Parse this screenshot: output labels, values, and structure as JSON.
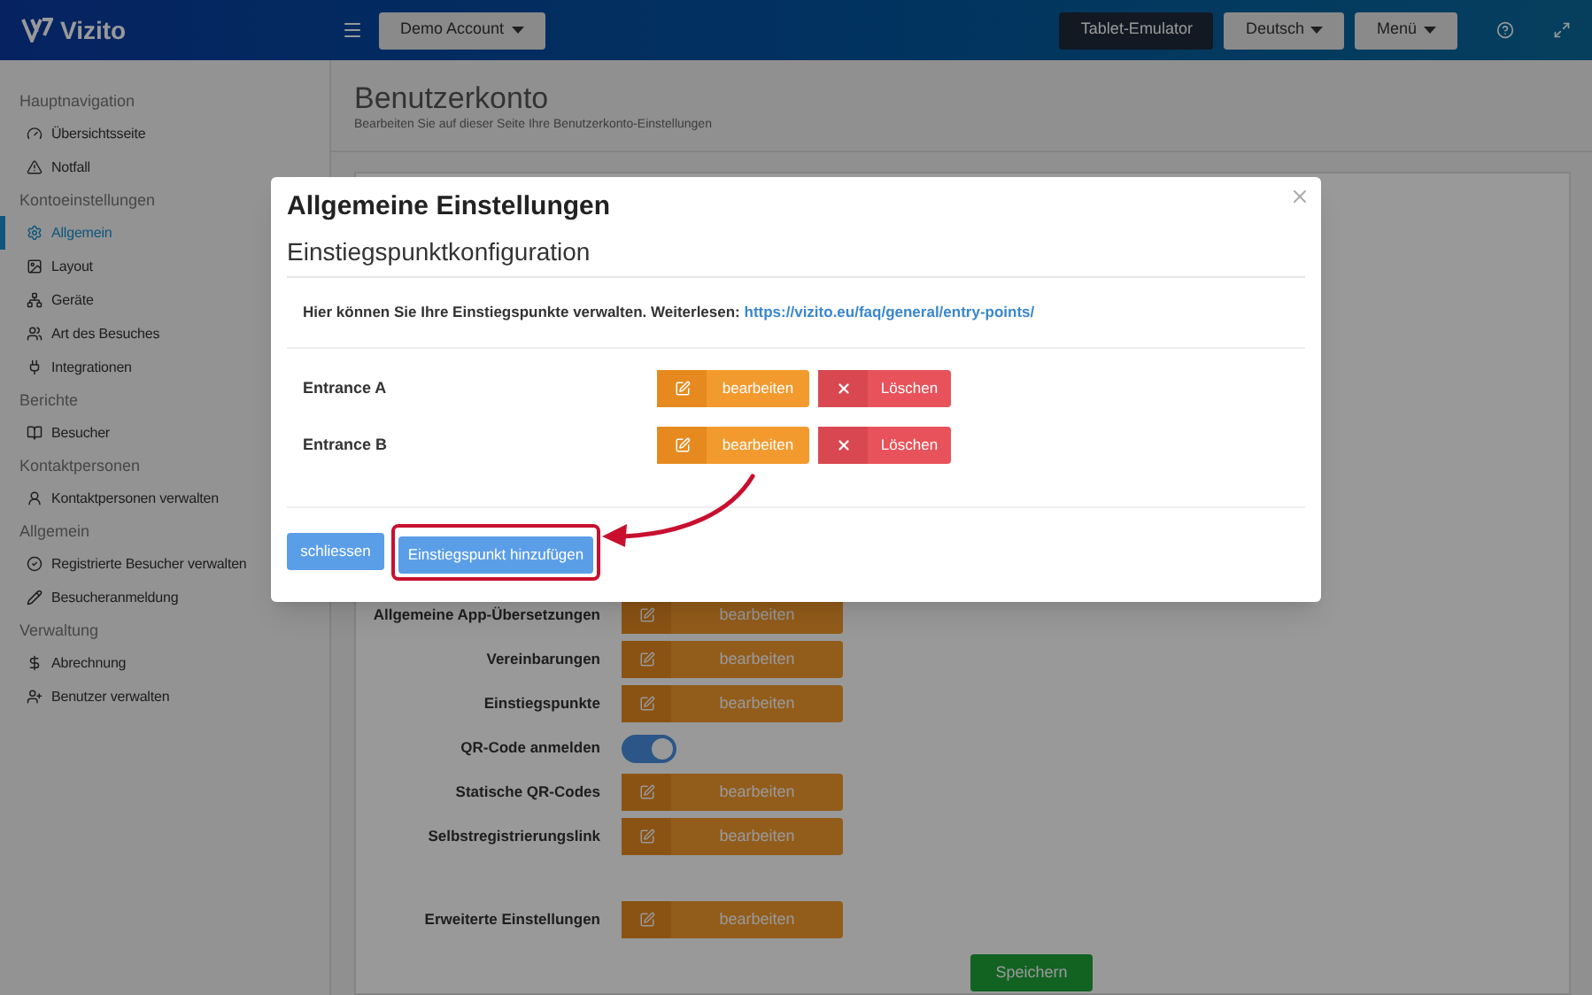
{
  "header": {
    "logo": "Vizito",
    "account": "Demo Account",
    "buttons": [
      {
        "label": "Tablet-Emulator",
        "kind": "dark"
      },
      {
        "label": "Deutsch",
        "kind": "dropdown"
      },
      {
        "label": "Menü",
        "kind": "dropdown"
      }
    ]
  },
  "sidebar": {
    "sections": [
      {
        "title": "Hauptnavigation",
        "items": [
          {
            "label": "Übersichtsseite",
            "selected": false
          },
          {
            "label": "Notfall",
            "selected": false
          }
        ]
      },
      {
        "title": "Kontoeinstellungen",
        "items": [
          {
            "label": "Allgemein",
            "selected": true
          },
          {
            "label": "Layout",
            "selected": false
          },
          {
            "label": "Geräte",
            "selected": false
          },
          {
            "label": "Art des Besuches",
            "selected": false
          },
          {
            "label": "Integrationen",
            "selected": false
          }
        ]
      },
      {
        "title": "Berichte",
        "items": [
          {
            "label": "Besucher",
            "selected": false
          }
        ]
      },
      {
        "title": "Kontaktpersonen",
        "items": [
          {
            "label": "Kontaktpersonen verwalten",
            "selected": false
          }
        ]
      },
      {
        "title": "Allgemein",
        "items": [
          {
            "label": "Registrierte Besucher verwalten",
            "selected": false
          },
          {
            "label": "Besucheranmeldung",
            "selected": false
          }
        ]
      },
      {
        "title": "Verwaltung",
        "items": [
          {
            "label": "Abrechnung",
            "selected": false
          },
          {
            "label": "Benutzer verwalten",
            "selected": false
          }
        ]
      }
    ]
  },
  "page": {
    "title": "Benutzerkonto",
    "subtitle": "Bearbeiten Sie auf dieser Seite Ihre Benutzerkonto-Einstellungen"
  },
  "settings": {
    "rows": [
      {
        "label": "Allgemeine App-Übersetzungen",
        "kind": "button",
        "button": "bearbeiten"
      },
      {
        "label": "Vereinbarungen",
        "kind": "button",
        "button": "bearbeiten"
      },
      {
        "label": "Einstiegspunkte",
        "kind": "button",
        "button": "bearbeiten"
      },
      {
        "label": "QR-Code anmelden",
        "kind": "toggle",
        "on": true
      },
      {
        "label": "Statische QR-Codes",
        "kind": "button",
        "button": "bearbeiten"
      },
      {
        "label": "Selbstregistrierungslink",
        "kind": "button",
        "button": "bearbeiten"
      }
    ],
    "advanced": {
      "label": "Erweiterte Einstellungen",
      "button": "bearbeiten"
    },
    "save": "Speichern"
  },
  "modal": {
    "title": "Allgemeine Einstellungen",
    "subtitle": "Einstiegspunktkonfiguration",
    "intro": "Hier können Sie Ihre Einstiegspunkte verwalten. Weiterlesen:",
    "link": "https://vizito.eu/faq/general/entry-points/",
    "entries": [
      {
        "name": "Entrance A",
        "edit": "bearbeiten",
        "delete": "Löschen"
      },
      {
        "name": "Entrance B",
        "edit": "bearbeiten",
        "delete": "Löschen"
      }
    ],
    "close": "schliessen",
    "add": "Einstiegspunkt hinzufügen"
  }
}
